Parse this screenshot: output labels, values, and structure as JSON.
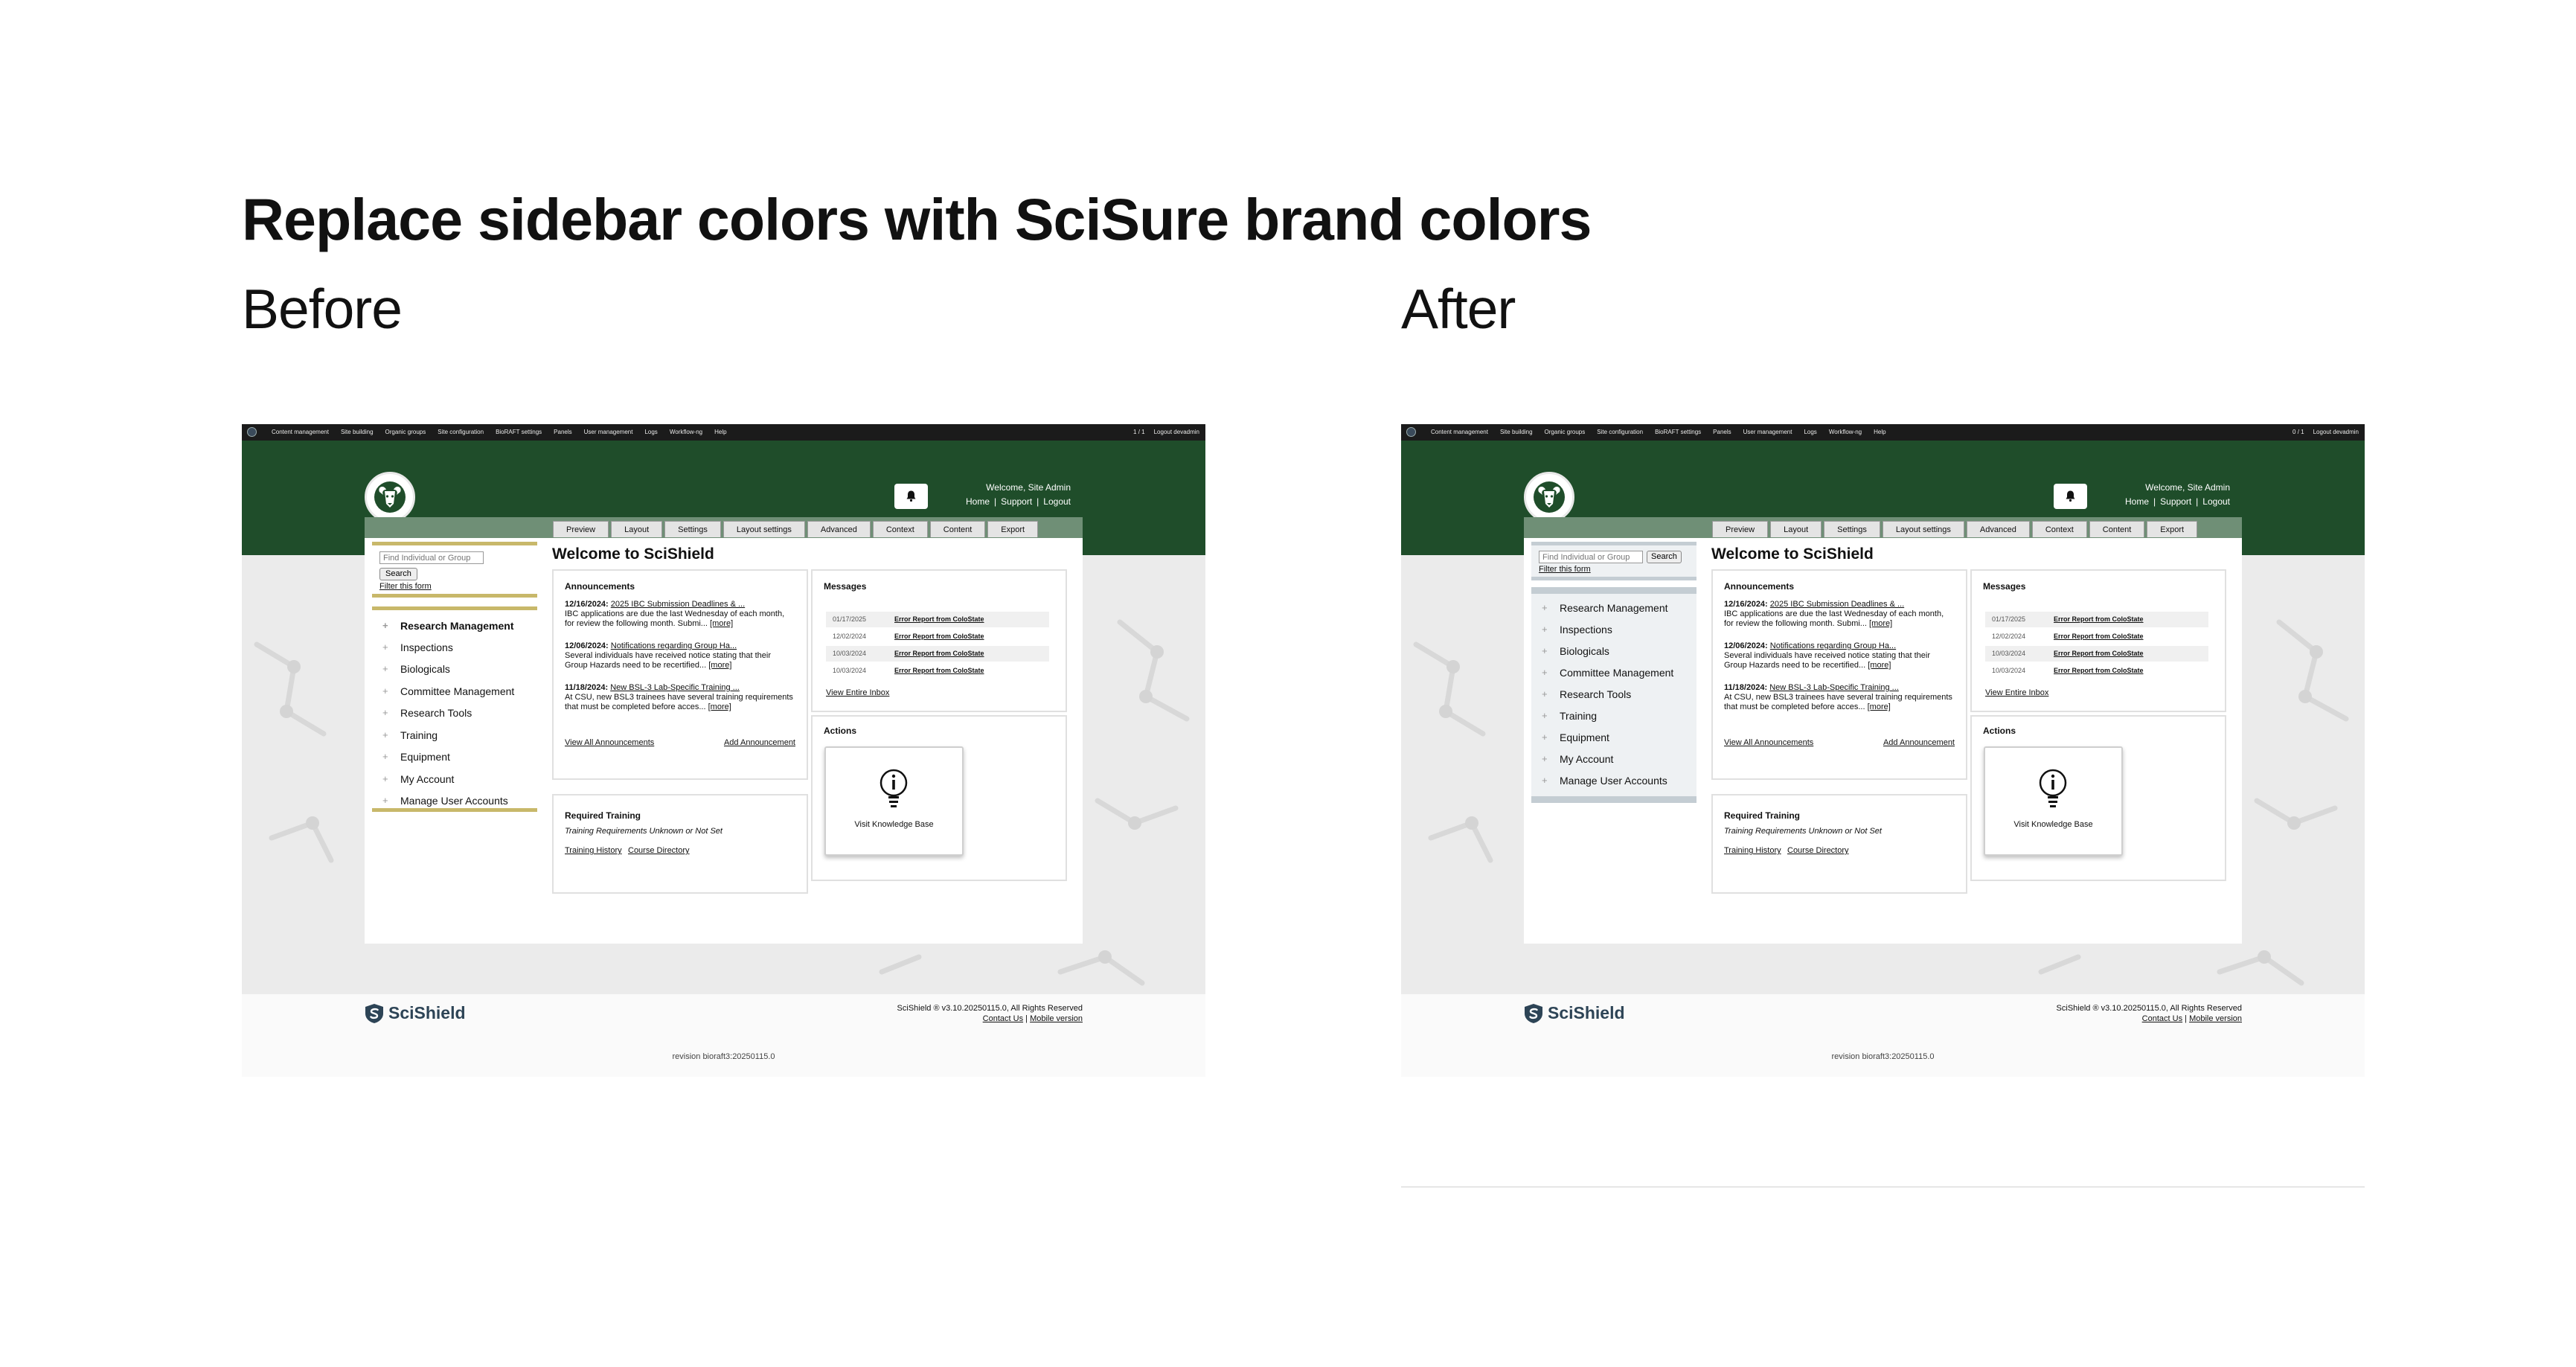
{
  "heading": "Replace sidebar colors with SciSure brand colors",
  "labels": {
    "before": "Before",
    "after": "After"
  },
  "screens": {
    "before": {
      "admin_menu": [
        "Content management",
        "Site building",
        "Organic groups",
        "Site configuration",
        "BioRAFT settings",
        "Panels",
        "User management",
        "Logs",
        "Workflow-ng",
        "Help"
      ],
      "admin_counter": "1 / 1",
      "admin_logout": "Logout devadmin",
      "welcome": "Welcome, Site Admin",
      "header_links": [
        "Home",
        "Support",
        "Logout"
      ],
      "site_code": "RC",
      "tabs": [
        "Preview",
        "Layout",
        "Settings",
        "Layout settings",
        "Advanced",
        "Context",
        "Content",
        "Export"
      ],
      "page_title": "Welcome to SciShield",
      "search_placeholder": "Find Individual or Group",
      "search_button": "Search",
      "filter_link": "Filter this form",
      "nav": [
        "Research Management",
        "Inspections",
        "Biologicals",
        "Committee Management",
        "Research Tools",
        "Training",
        "Equipment",
        "My Account",
        "Manage User Accounts"
      ],
      "revision": "revision bioraft3:20250115.0"
    },
    "after": {
      "admin_menu": [
        "Content management",
        "Site building",
        "Organic groups",
        "Site configuration",
        "BioRAFT settings",
        "Panels",
        "User management",
        "Logs",
        "Workflow-ng",
        "Help"
      ],
      "admin_counter": "0 / 1",
      "admin_logout": "Logout devadmin",
      "welcome": "Welcome, Site Admin",
      "header_links": [
        "Home",
        "Support",
        "Logout"
      ],
      "site_code": "RC",
      "tabs": [
        "Preview",
        "Layout",
        "Settings",
        "Layout settings",
        "Advanced",
        "Context",
        "Content",
        "Export"
      ],
      "page_title": "Welcome to SciShield",
      "search_placeholder": "Find Individual or Group",
      "search_button": "Search",
      "filter_link": "Filter this form",
      "nav": [
        "Research Management",
        "Inspections",
        "Biologicals",
        "Committee Management",
        "Research Tools",
        "Training",
        "Equipment",
        "My Account",
        "Manage User Accounts"
      ],
      "revision": "revision bioraft3:20250115.0"
    }
  },
  "announcements": {
    "title": "Announcements",
    "items": [
      {
        "date": "12/16/2024:",
        "title": "2025 IBC Submission Deadlines & ...",
        "body": "IBC applications are due the last Wednesday of each month, for review the following month. Submi...",
        "more": "[more]"
      },
      {
        "date": "12/06/2024:",
        "title": "Notifications regarding Group Ha...",
        "body": "Several individuals have received notice stating that their Group Hazards need to be recertified...",
        "more": "[more]"
      },
      {
        "date": "11/18/2024:",
        "title": "New BSL-3 Lab-Specific Training ...",
        "body": "At CSU, new BSL3 trainees have several training requirements that must be completed before acces...",
        "more": "[more]"
      }
    ],
    "view_all": "View All Announcements",
    "add": "Add Announcement"
  },
  "messages": {
    "title": "Messages",
    "rows": [
      {
        "date": "01/17/2025",
        "subject": "Error Report from ColoState"
      },
      {
        "date": "12/02/2024",
        "subject": "Error Report from ColoState"
      },
      {
        "date": "10/03/2024",
        "subject": "Error Report from ColoState"
      },
      {
        "date": "10/03/2024",
        "subject": "Error Report from ColoState"
      }
    ],
    "view_inbox": "View Entire Inbox"
  },
  "actions": {
    "title": "Actions",
    "kb_label": "Visit Knowledge Base"
  },
  "training": {
    "title": "Required Training",
    "status": "Training Requirements Unknown or Not Set",
    "history": "Training History",
    "directory": "Course Directory"
  },
  "footer": {
    "brand": "SciShield",
    "copyright": "SciShield ® v3.10.20250115.0, All Rights Reserved",
    "contact": "Contact Us",
    "mobile": "Mobile version"
  },
  "colors": {
    "header_green": "#1f4d2a",
    "before_sidebar_accent": "#c8b86a",
    "after_sidebar_accent": "#c4cdd3",
    "background_gray": "#ebebeb"
  }
}
